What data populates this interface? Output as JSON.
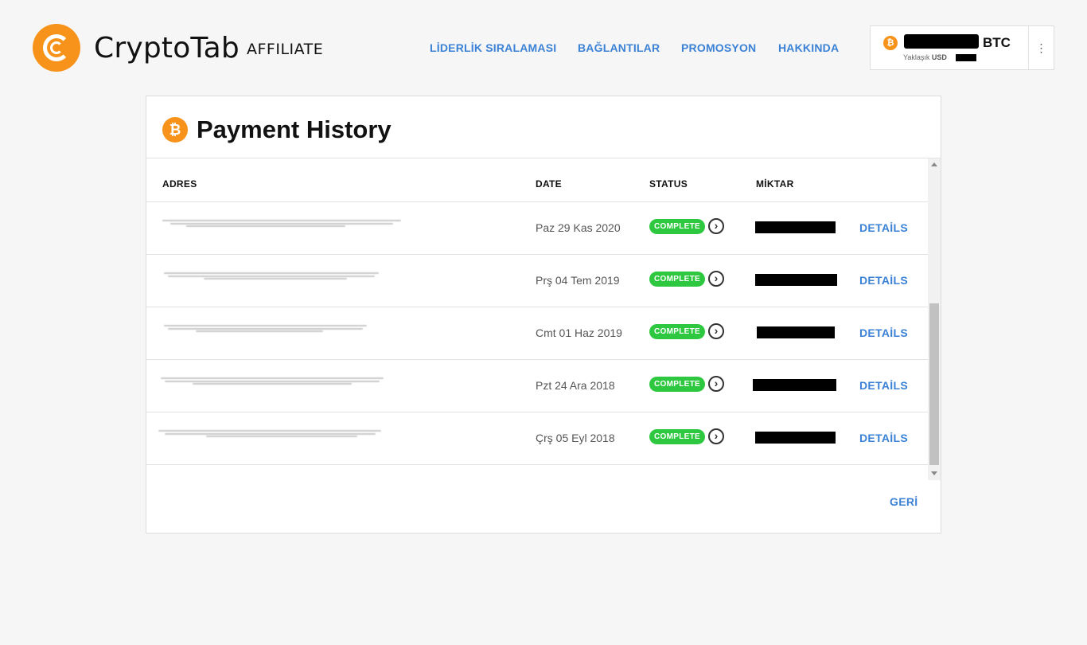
{
  "header": {
    "brand": "CryptoTab",
    "brand_sub": "AFFILIATE",
    "nav": [
      {
        "label": "LİDERLİK SIRALAMASI"
      },
      {
        "label": "BAĞLANTILAR"
      },
      {
        "label": "PROMOSYON"
      },
      {
        "label": "HAKKINDA"
      }
    ],
    "balance": {
      "unit": "BTC",
      "approx_label": "Yaklaşık",
      "approx_currency": "USD",
      "menu_icon": "⋮"
    }
  },
  "card": {
    "title": "Payment History",
    "coin_icon": "₿",
    "columns": {
      "address": "ADRES",
      "date": "DATE",
      "status": "STATUS",
      "amount": "MİKTAR"
    },
    "rows": [
      {
        "date": "Paz 29 Kas 2020",
        "status": "COMPLETE",
        "action": "DETAİLS"
      },
      {
        "date": "Prş 04 Tem 2019",
        "status": "COMPLETE",
        "action": "DETAİLS"
      },
      {
        "date": "Cmt 01 Haz 2019",
        "status": "COMPLETE",
        "action": "DETAİLS"
      },
      {
        "date": "Pzt 24 Ara 2018",
        "status": "COMPLETE",
        "action": "DETAİLS"
      },
      {
        "date": "Çrş 05 Eyl 2018",
        "status": "COMPLETE",
        "action": "DETAİLS"
      }
    ],
    "back_label": "GERİ"
  },
  "colors": {
    "accent_blue": "#3b82d6",
    "bitcoin_orange": "#f7931a",
    "status_green": "#2ec840"
  }
}
